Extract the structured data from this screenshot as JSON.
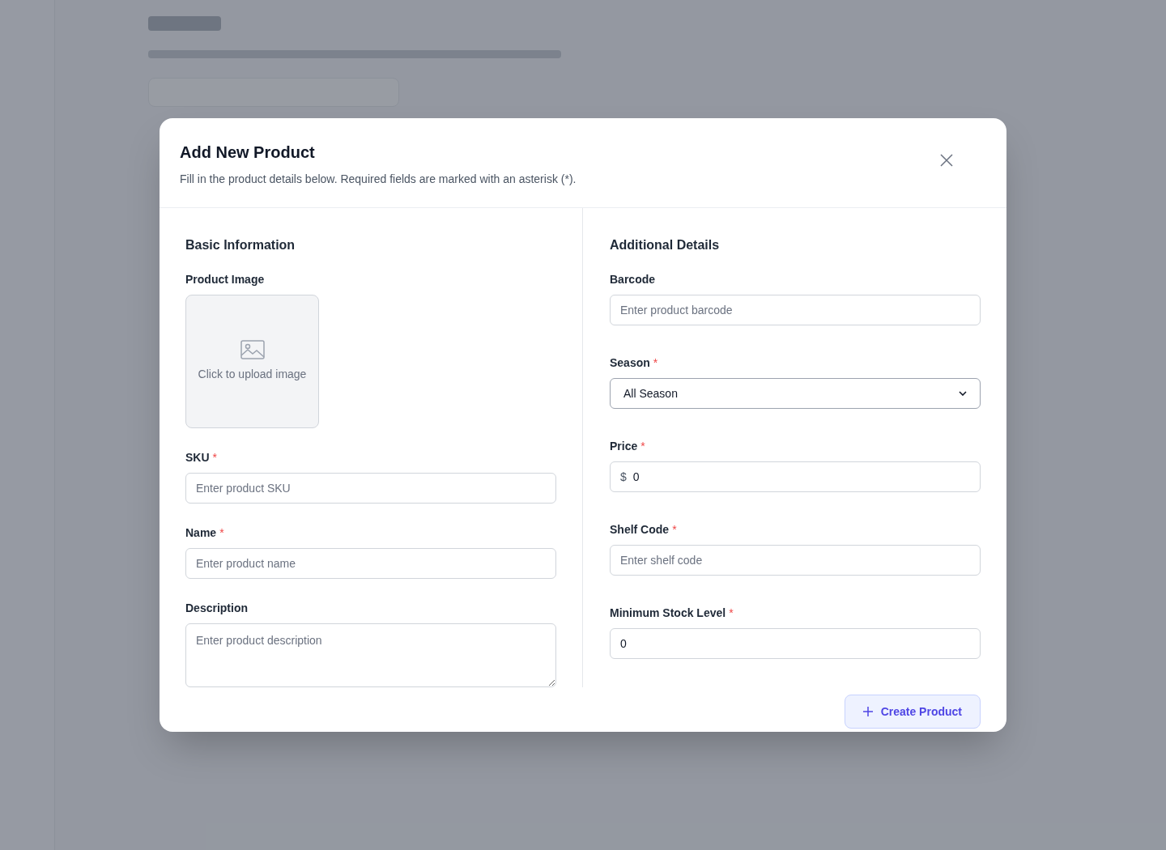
{
  "dialog": {
    "title": "Add New Product",
    "subtitle": "Fill in the product details below. Required fields are marked with an asterisk (*)."
  },
  "sections": [
    {
      "title": "Basic Information",
      "fields": [
        {
          "kind": "image",
          "label": "Product Image",
          "required": false,
          "upload_text": "Click to upload image"
        },
        {
          "kind": "text",
          "label": "SKU",
          "required": true,
          "placeholder": "Enter product SKU"
        },
        {
          "kind": "text",
          "label": "Name",
          "required": true,
          "placeholder": "Enter product name"
        },
        {
          "kind": "textarea",
          "label": "Description",
          "required": false,
          "placeholder": "Enter product description"
        }
      ]
    },
    {
      "title": "Additional Details",
      "fields": [
        {
          "kind": "text",
          "label": "Barcode",
          "required": false,
          "placeholder": "Enter product barcode"
        },
        {
          "kind": "select",
          "label": "Season",
          "required": true,
          "value": "All Season"
        },
        {
          "kind": "currency",
          "label": "Price",
          "required": true,
          "prefix": "$",
          "value": "0"
        },
        {
          "kind": "text",
          "label": "Shelf Code",
          "required": true,
          "placeholder": "Enter shelf code"
        },
        {
          "kind": "text",
          "label": "Minimum Stock Level",
          "required": true,
          "value": "0"
        }
      ]
    }
  ],
  "required_mark": "*",
  "submit_button": {
    "label": "Create Product"
  }
}
